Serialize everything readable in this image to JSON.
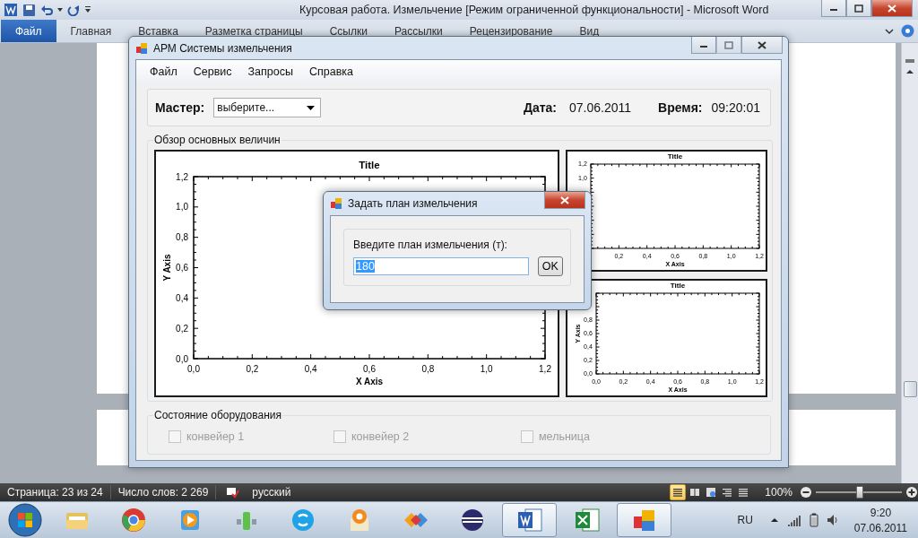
{
  "word_window": {
    "title": "Курсовая работа. Измельчение [Режим ограниченной функциональности]  -  Microsoft Word",
    "file_tab": "Файл",
    "tabs": [
      "Главная",
      "Вставка",
      "Разметка страницы",
      "Ссылки",
      "Рассылки",
      "Рецензирование",
      "Вид"
    ]
  },
  "app_window": {
    "title": "АРМ Системы измельчения",
    "menu": [
      "Файл",
      "Сервис",
      "Запросы",
      "Справка"
    ],
    "master_label": "Мастер:",
    "master_select": {
      "value": "выберите..."
    },
    "date_label": "Дата:",
    "date": "07.06.2011",
    "time_label": "Время:",
    "time": "09:20:01",
    "overview_group": {
      "title": "Обзор основных величин",
      "charts": [
        {
          "chart_data": {
            "type": "line",
            "title": "Title",
            "xlabel": "X Axis",
            "ylabel": "Y Axis",
            "xlim": [
              0,
              1.2
            ],
            "ylim": [
              0,
              1.2
            ],
            "xticks": [
              {
                "value": 0,
                "label": "0,0"
              },
              {
                "value": 0.2,
                "label": "0,2"
              },
              {
                "value": 0.4,
                "label": "0,4"
              },
              {
                "value": 0.6,
                "label": "0,6"
              },
              {
                "value": 0.8,
                "label": "0,8"
              },
              {
                "value": 1.0,
                "label": "1,0"
              },
              {
                "value": 1.2,
                "label": "1,2"
              }
            ],
            "yticks": [
              {
                "value": 0,
                "label": "0,0"
              },
              {
                "value": 0.2,
                "label": "0,2"
              },
              {
                "value": 0.4,
                "label": "0,4"
              },
              {
                "value": 0.6,
                "label": "0,6"
              },
              {
                "value": 0.8,
                "label": "0,8"
              },
              {
                "value": 1.0,
                "label": "1,0"
              },
              {
                "value": 1.2,
                "label": "1,2"
              }
            ]
          }
        },
        {
          "chart_data": {
            "type": "line",
            "title": "Title",
            "xlabel": "X Axis",
            "xlim": [
              0,
              1.2
            ],
            "ylim": [
              0,
              1.2
            ],
            "xticks": [
              {
                "value": 0.2,
                "label": "0,2"
              },
              {
                "value": 0.4,
                "label": "0,4"
              },
              {
                "value": 0.6,
                "label": "0,6"
              },
              {
                "value": 0.8,
                "label": "0,8"
              },
              {
                "value": 1.0,
                "label": "1,0"
              },
              {
                "value": 1.2,
                "label": "1,2"
              }
            ],
            "yticks": [
              {
                "value": 1.0,
                "label": "1,0"
              },
              {
                "value": 1.2,
                "label": "1,2"
              }
            ]
          }
        },
        {
          "chart_data": {
            "type": "line",
            "title": "Title",
            "xlabel": "X Axis",
            "ylabel": "Y Axis",
            "xlim": [
              0,
              1.2
            ],
            "ylim": [
              0,
              1.2
            ],
            "xticks": [
              {
                "value": 0,
                "label": "0,0"
              },
              {
                "value": 0.2,
                "label": "0,2"
              },
              {
                "value": 0.4,
                "label": "0,4"
              },
              {
                "value": 0.6,
                "label": "0,6"
              },
              {
                "value": 0.8,
                "label": "0,8"
              },
              {
                "value": 1.0,
                "label": "1,0"
              },
              {
                "value": 1.2,
                "label": "1,2"
              }
            ],
            "yticks": [
              {
                "value": 0,
                "label": "0,0"
              },
              {
                "value": 0.2,
                "label": "0,2"
              },
              {
                "value": 0.4,
                "label": "0,4"
              },
              {
                "value": 0.6,
                "label": "0,6"
              },
              {
                "value": 0.8,
                "label": "0,8"
              }
            ]
          }
        }
      ]
    },
    "equipment_group": {
      "title": "Состояние оборудования",
      "items": [
        {
          "label": "конвейер 1",
          "checked": false,
          "disabled": true
        },
        {
          "label": "конвейер 2",
          "checked": false,
          "disabled": true
        },
        {
          "label": "мельница",
          "checked": false,
          "disabled": true
        }
      ]
    }
  },
  "dialog": {
    "title": "Задать план измельчения",
    "prompt": "Введите план измельчения (т):",
    "input": {
      "value": "180",
      "highlighted": true
    },
    "ok_button": "OK"
  },
  "status_bar": {
    "page": "Страница: 23 из 24",
    "words": "Число слов: 2 269",
    "language": "русский",
    "view_buttons": [
      {
        "kind": "print",
        "selected": true
      },
      {
        "kind": "reading",
        "selected": false
      },
      {
        "kind": "web",
        "selected": false
      },
      {
        "kind": "outline",
        "selected": false
      },
      {
        "kind": "draft",
        "selected": false
      }
    ],
    "zoom": "100%",
    "zoom_slider": {
      "level": 0.5
    }
  },
  "taskbar": {
    "apps": [
      {
        "kind": "folder",
        "selected": false
      },
      {
        "kind": "browser",
        "selected": false
      },
      {
        "kind": "player",
        "selected": false
      },
      {
        "kind": "gadget",
        "selected": false
      },
      {
        "kind": "chat",
        "selected": false
      },
      {
        "kind": "map",
        "selected": false
      },
      {
        "kind": "puzzle",
        "selected": false
      },
      {
        "kind": "sphere",
        "selected": false
      },
      {
        "kind": "word",
        "selected": true
      },
      {
        "kind": "excel",
        "selected": false
      },
      {
        "kind": "app",
        "selected": true
      }
    ],
    "language": "RU",
    "time": "9:20",
    "date": "07.06.2011"
  }
}
